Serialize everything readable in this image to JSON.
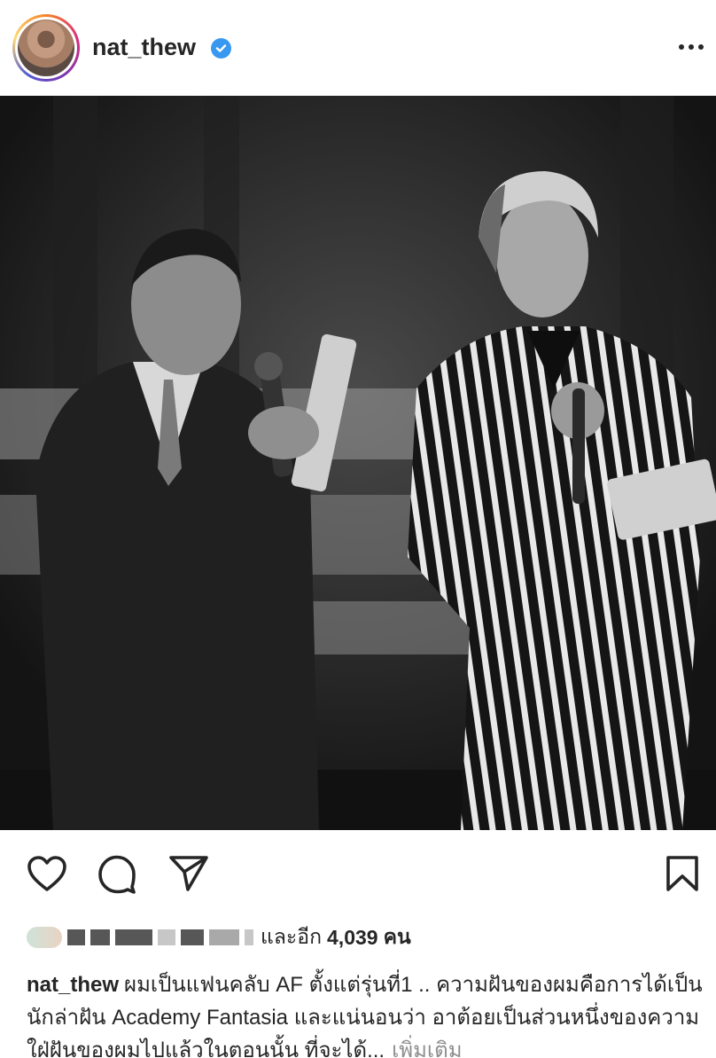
{
  "post": {
    "username": "nat_thew",
    "verified": true,
    "more_icon": "more-horizontal-icon"
  },
  "actions": {
    "like_icon": "heart-icon",
    "comment_icon": "comment-icon",
    "share_icon": "send-icon",
    "save_icon": "bookmark-icon"
  },
  "likes": {
    "suffix_text": "และอีก",
    "count": "4,039",
    "count_unit": "คน"
  },
  "caption": {
    "username": "nat_thew",
    "text": "ผมเป็นแฟนคลับ AF ตั้งแต่รุ่นที่1 .. ความฝันของผมคือการได้เป็นนักล่าฝัน Academy Fantasia และแน่นอนว่า อาต้อยเป็นส่วนหนึ่งของความใฝ่ฝันของผมไปแล้วในตอนนั้น ที่จะได้...",
    "more_label": "เพิ่มเติม"
  },
  "colors": {
    "text": "#262626",
    "muted": "#8e8e8e",
    "verified": "#3897f0"
  }
}
